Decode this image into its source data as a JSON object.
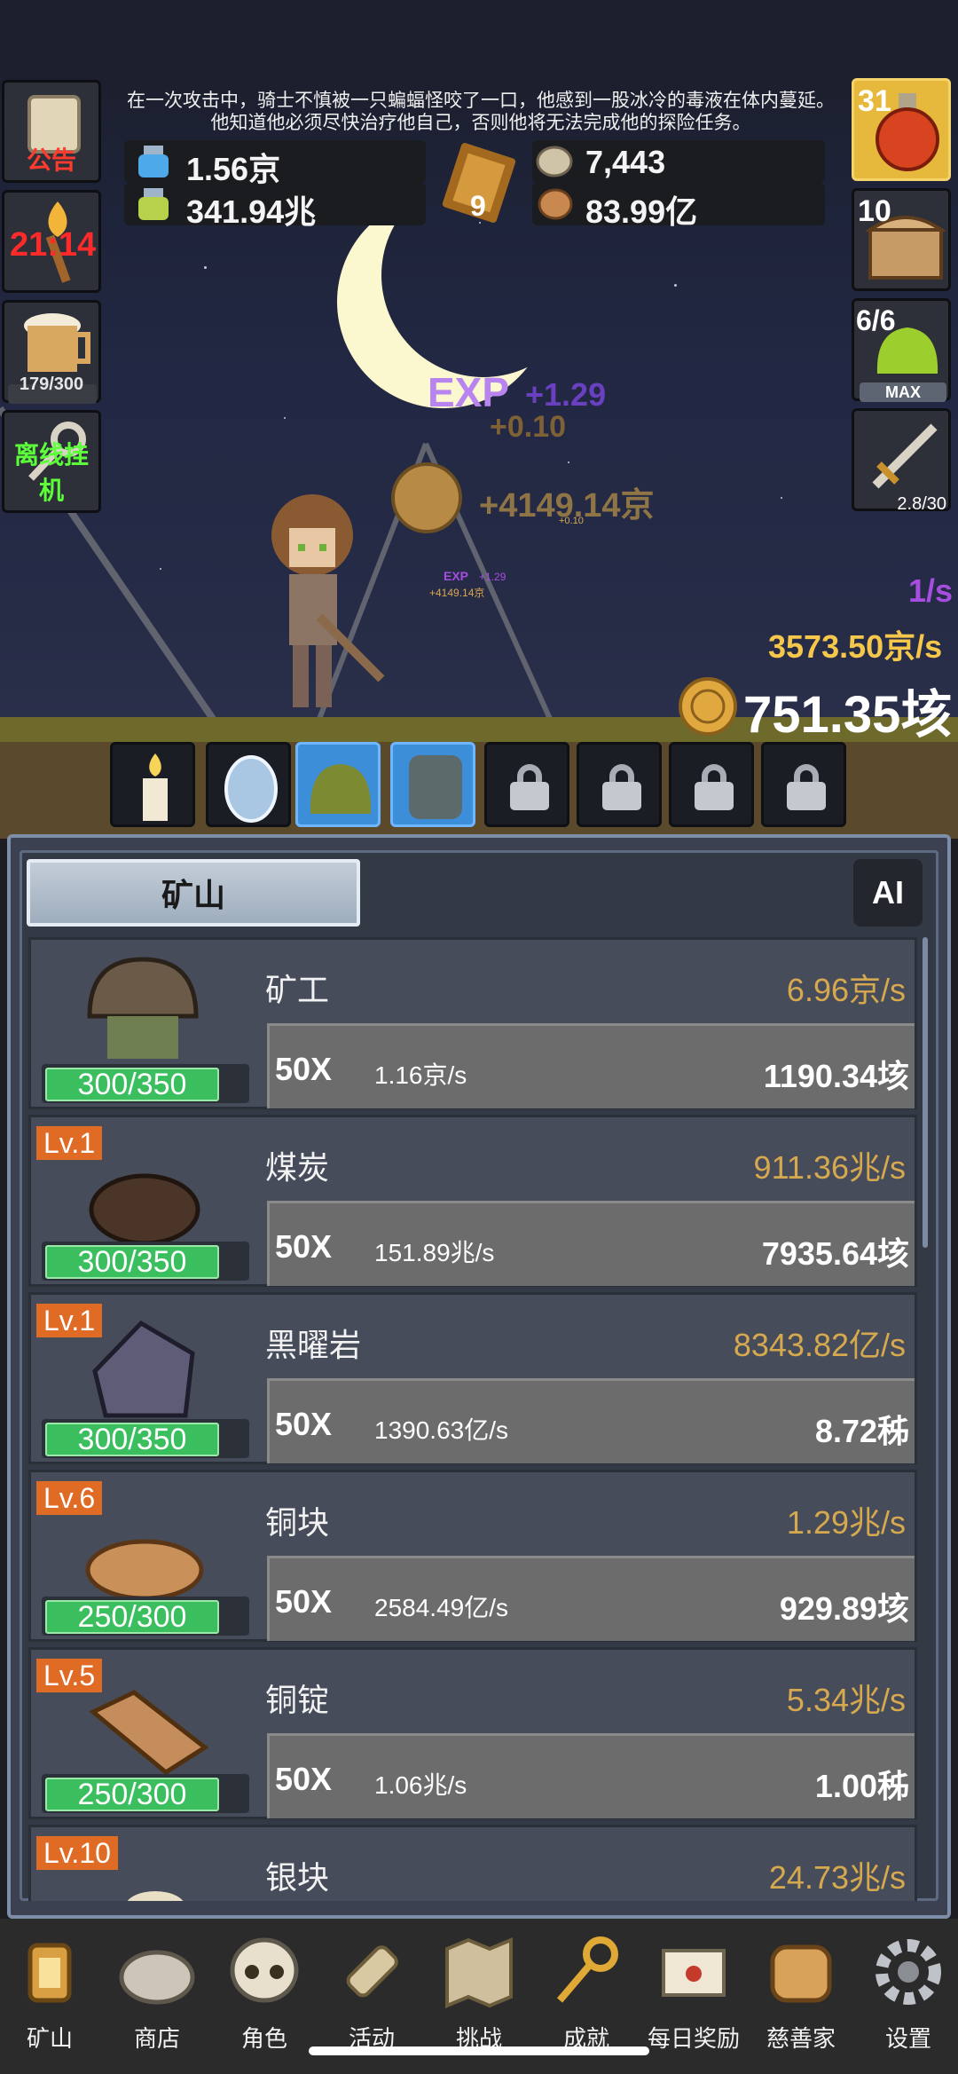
{
  "story": {
    "line1": "在一次攻击中，骑士不慎被一只蝙蝠怪咬了一口，他感到一股冰冷的毒液在体内蔓延。",
    "line2": "他知道他必须尽快治疗他自己，否则他将无法完成他的探险任务。"
  },
  "left_buttons": {
    "notice": "公告",
    "torch_timer": "21:14",
    "beer_count": "179/300",
    "offline": "离线挂机"
  },
  "right_buttons": {
    "potion_count": "31",
    "chest_count": "10",
    "slime_count": "6/6",
    "slime_max": "MAX",
    "sword_count": "2.8/30"
  },
  "resources": {
    "blue_potion": "1.56京",
    "green_potion": "341.94兆",
    "book_level": "9",
    "stone": "7,443",
    "seed": "83.99亿"
  },
  "floating": {
    "exp_label": "EXP",
    "exp_gain": "+1.29",
    "small_gain": "+0.10",
    "gold_gain": "+4149.14京",
    "mini_exp": "+1.29",
    "mini_gold": "+4149.14京",
    "mini_small": "+0.10"
  },
  "stats": {
    "attack_speed": "1/s",
    "gold_rate": "3573.50京/s",
    "gold_total": "751.35垓"
  },
  "colors": {
    "gold_text": "#d7a94f",
    "exp_purple": "#a54ee0",
    "green_bar": "#3bbf5e",
    "level_orange": "#e06b24",
    "active_slot": "#3d8ed8"
  },
  "panel": {
    "tab_label": "矿山",
    "ai_label": "AI"
  },
  "mine_rows": [
    {
      "level": "",
      "name": "矿工",
      "rate": "6.96京/s",
      "cap": "300/350",
      "mult": "50X",
      "each": "1.16京/s",
      "cost": "1190.34垓"
    },
    {
      "level": "Lv.1",
      "name": "煤炭",
      "rate": "911.36兆/s",
      "cap": "300/350",
      "mult": "50X",
      "each": "151.89兆/s",
      "cost": "7935.64垓"
    },
    {
      "level": "Lv.1",
      "name": "黑曜岩",
      "rate": "8343.82亿/s",
      "cap": "300/350",
      "mult": "50X",
      "each": "1390.63亿/s",
      "cost": "8.72秭"
    },
    {
      "level": "Lv.6",
      "name": "铜块",
      "rate": "1.29兆/s",
      "cap": "250/300",
      "mult": "50X",
      "each": "2584.49亿/s",
      "cost": "929.89垓"
    },
    {
      "level": "Lv.5",
      "name": "铜锭",
      "rate": "5.34兆/s",
      "cap": "250/300",
      "mult": "50X",
      "each": "1.06兆/s",
      "cost": "1.00秭"
    },
    {
      "level": "Lv.10",
      "name": "银块",
      "rate": "24.73兆/s",
      "cap": "",
      "mult": "",
      "each": "",
      "cost": ""
    }
  ],
  "nav": [
    {
      "label": "矿山",
      "icon": "lantern-icon"
    },
    {
      "label": "商店",
      "icon": "stone-icon"
    },
    {
      "label": "角色",
      "icon": "skull-icon"
    },
    {
      "label": "活动",
      "icon": "scroll-icon"
    },
    {
      "label": "挑战",
      "icon": "map-icon"
    },
    {
      "label": "成就",
      "icon": "key-icon"
    },
    {
      "label": "每日奖励",
      "icon": "letter-icon"
    },
    {
      "label": "慈善家",
      "icon": "bread-icon"
    },
    {
      "label": "设置",
      "icon": "gear-icon"
    }
  ]
}
